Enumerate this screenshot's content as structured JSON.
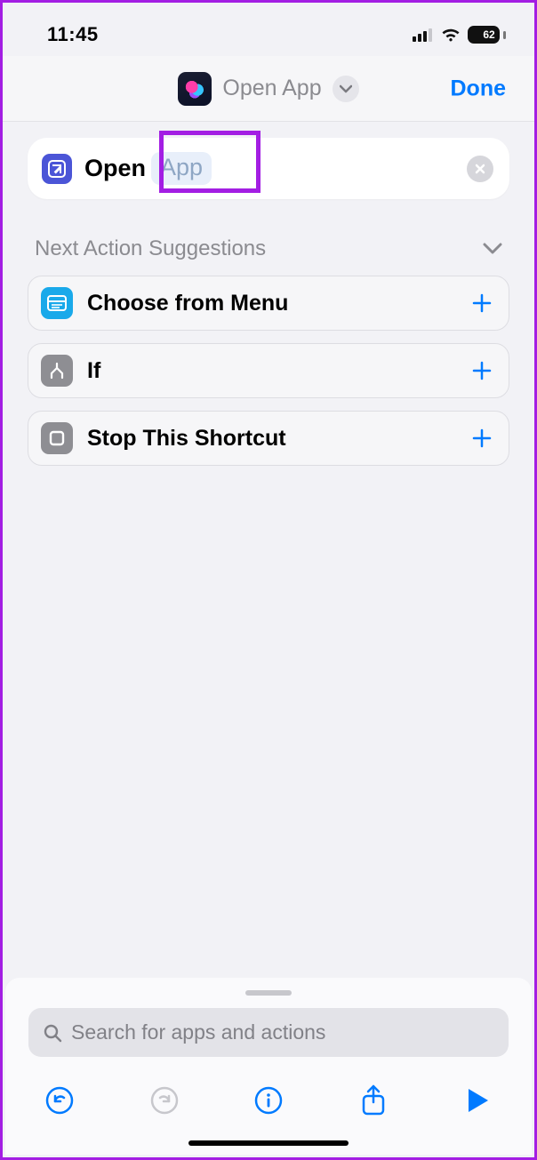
{
  "status_bar": {
    "time": "11:45",
    "battery_percent": "62"
  },
  "header": {
    "title": "Open App",
    "done_label": "Done"
  },
  "action_card": {
    "open_label": "Open",
    "app_chip": "App"
  },
  "suggestions": {
    "header": "Next Action Suggestions",
    "items": [
      {
        "label": "Choose from Menu",
        "icon": "menu"
      },
      {
        "label": "If",
        "icon": "if"
      },
      {
        "label": "Stop This Shortcut",
        "icon": "stop"
      }
    ]
  },
  "search": {
    "placeholder": "Search for apps and actions"
  },
  "colors": {
    "accent": "#007aff",
    "highlight": "#a31ee3"
  }
}
